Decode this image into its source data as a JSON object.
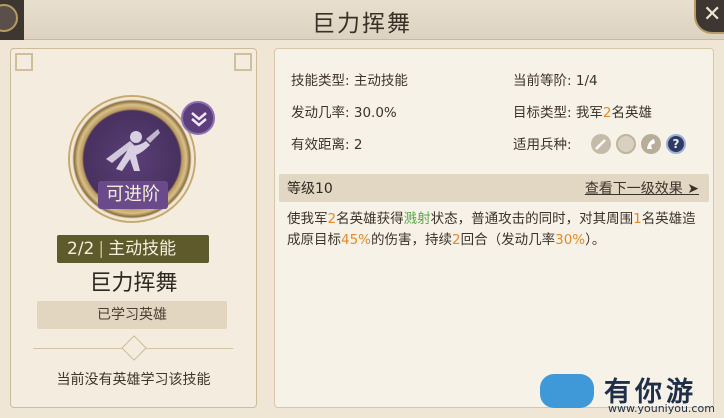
{
  "header": {
    "title": "巨力挥舞",
    "close_icon": "close-icon"
  },
  "skill_card": {
    "advance_label": "可进阶",
    "advance_badge_icon": "chevron-double-down-icon",
    "level_count": "2/2",
    "skill_kind": "主动技能",
    "skill_name": "巨力挥舞",
    "learned_button": "已学习英雄",
    "no_hero_text": "当前没有英雄学习该技能"
  },
  "details": {
    "skill_type_label": "技能类型:",
    "skill_type_value": "主动技能",
    "current_tier_label": "当前等阶:",
    "current_tier_value": "1/4",
    "trigger_rate_label": "发动几率:",
    "trigger_rate_value": "30.0%",
    "target_type_label": "目标类型:",
    "target_type_prefix": "我军",
    "target_type_count": "2",
    "target_type_suffix": "名英雄",
    "range_label": "有效距离:",
    "range_value": "2",
    "unit_label": "适用兵种:",
    "unit_icons": [
      "sword-icon",
      "shield-icon",
      "horse-icon",
      "question-icon"
    ],
    "unit_help_glyph": "?"
  },
  "level_section": {
    "level_text": "等级10",
    "next_effect_link": "查看下一级效果 ➤"
  },
  "description": {
    "p1": "使我军",
    "n1": "2",
    "p2": "名英雄获得",
    "status": "溅射",
    "p3": "状态，普通攻击的同时，对其周围",
    "n2": "1",
    "p4": "名英雄造成原目标",
    "pct": "45%",
    "p5": "的伤害，持续",
    "n3": "2",
    "p6": "回合（发动几率",
    "rate": "30%",
    "p7": "）。"
  },
  "watermark": {
    "brand": "有你游",
    "url": "www.youniyou.com"
  },
  "colors": {
    "highlight_orange": "#e28a2b",
    "status_green": "#56a84a",
    "skill_purple": "#6b4a8c",
    "level_bar_olive": "#5f5a2b"
  }
}
